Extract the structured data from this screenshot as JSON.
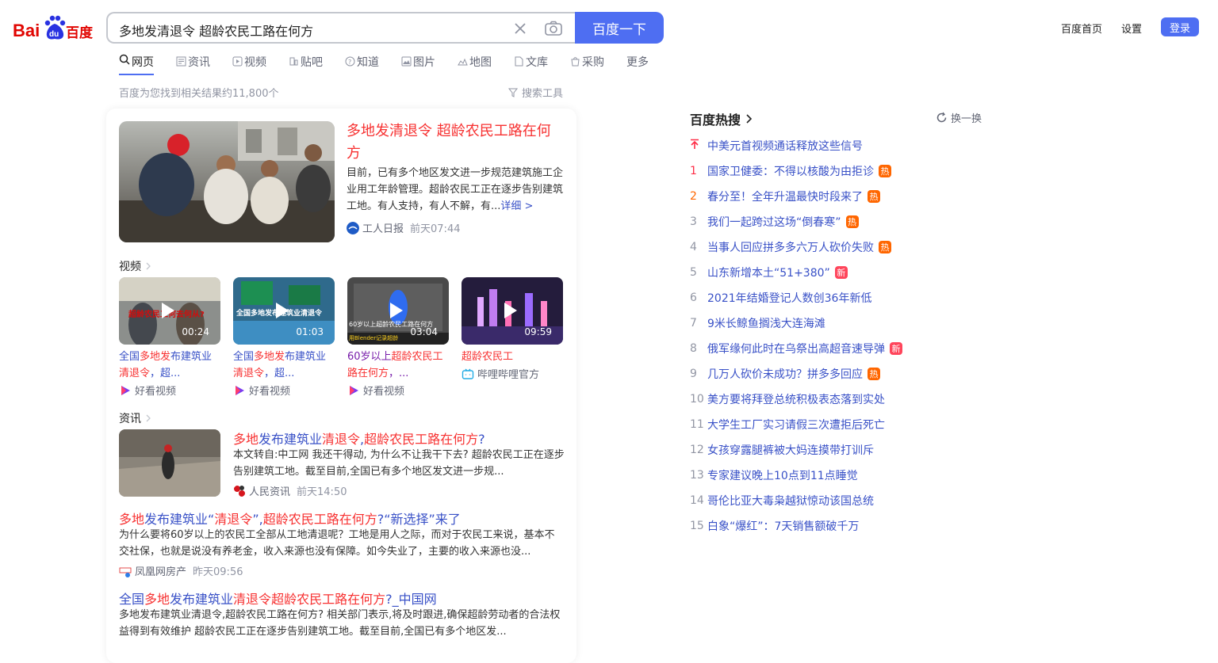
{
  "header": {
    "search_query": "多地发清退令 超龄农民工路在何方",
    "search_button": "百度一下",
    "links": [
      "百度首页",
      "设置"
    ],
    "login": "登录",
    "brand_color": "#4e6ef2"
  },
  "tabs": [
    {
      "label": "网页",
      "icon": "search-icon"
    },
    {
      "label": "资讯",
      "icon": "news-icon"
    },
    {
      "label": "视频",
      "icon": "video-icon"
    },
    {
      "label": "贴吧",
      "icon": "tieba-icon"
    },
    {
      "label": "知道",
      "icon": "question-icon"
    },
    {
      "label": "图片",
      "icon": "image-icon"
    },
    {
      "label": "地图",
      "icon": "map-icon"
    },
    {
      "label": "文库",
      "icon": "document-icon"
    },
    {
      "label": "采购",
      "icon": "shopping-icon"
    },
    {
      "label": "更多",
      "icon": ""
    }
  ],
  "result_count": "百度为您找到相关结果约11,800个",
  "search_tools": "搜索工具",
  "top_result": {
    "title": "多地发清退令 超龄农民工路在何方",
    "summary": "目前，已有多个地区发文进一步规范建筑施工企业用工年龄管理。超龄农民工正在逐步告别建筑工地。有人支持，有人不解，有...",
    "more": "详细 >",
    "source": "工人日报",
    "time": "前天07:44"
  },
  "video_section": {
    "label": "视频",
    "items": [
      {
        "duration": "00:24",
        "title_a": "全国",
        "title_em": "多地发",
        "title_b": "布建筑业",
        "title_em2": "清退令",
        "title_c": "，超...",
        "source": "好看视频"
      },
      {
        "duration": "01:03",
        "title_a": "全国",
        "title_em": "多地发",
        "title_b": "布建筑业",
        "title_em2": "清退令",
        "title_c": "，超...",
        "source": "好看视频"
      },
      {
        "duration": "03:04",
        "title_a": "60岁以上",
        "title_em": "超龄农民工",
        "title_b": "",
        "title_em2": "路在何方",
        "title_c": "，...",
        "source": "好看视频"
      },
      {
        "duration": "09:59",
        "title_a": "",
        "title_em": "超龄农民工",
        "title_b": "",
        "title_em2": "",
        "title_c": "",
        "source": "哔哩哔哩官方"
      }
    ]
  },
  "news_section": {
    "label": "资讯",
    "items": [
      {
        "t1": "多地",
        "t2": "发布建筑业",
        "t3": "清退令",
        "t4": ",",
        "t5": "超龄农民工路在何方",
        "t6": "?",
        "summary": "本文转自:中工网 我还干得动, 为什么不让我干下去? 超龄农民工正在逐步告别建筑工地。截至目前,全国已有多个地区发文进一步规...",
        "source": "人民资讯",
        "time": "前天14:50"
      },
      {
        "t1": "多地",
        "t2": "发布建筑业“",
        "t3": "清退令",
        "t4": "”,",
        "t5": "超龄农民工路在何方",
        "t6": "?“新选择”来了",
        "summary": "为什么要将60岁以上的农民工全部从工地清退呢？工地是用人之际，而对于农民工来说，基本不交社保，也就是说没有养老金，收入来源也没有保障。如今失业了，主要的收入来源也没...",
        "source": "凤凰网房产",
        "time": "昨天09:56"
      },
      {
        "t0": "全国",
        "t1": "多地",
        "t2": "发布建筑业",
        "t3": "清退令",
        "t4": "",
        "t5": "超龄农民工路在何方",
        "t6": "?_中国网",
        "summary": "多地发布建筑业清退令,超龄农民工路在何方? 相关部门表示,将及时跟进,确保超龄劳动者的合法权益得到有效维护 超龄农民工正在逐步告别建筑工地。截至目前,全国已有多个地区发..."
      }
    ]
  },
  "hot_search": {
    "title": "百度热搜",
    "refresh": "换一换",
    "items": [
      {
        "rank": "",
        "text": "中美元首视频通话释放这些信号",
        "tag": ""
      },
      {
        "rank": "1",
        "text": "国家卫健委：不得以核酸为由拒诊",
        "tag": "热"
      },
      {
        "rank": "2",
        "text": "春分至！全年升温最快时段来了",
        "tag": "热"
      },
      {
        "rank": "3",
        "text": "我们一起跨过这场“倒春寒”",
        "tag": "热"
      },
      {
        "rank": "4",
        "text": "当事人回应拼多多六万人砍价失败",
        "tag": "热"
      },
      {
        "rank": "5",
        "text": "山东新增本土“51+380”",
        "tag": "新"
      },
      {
        "rank": "6",
        "text": "2021年结婚登记人数创36年新低",
        "tag": ""
      },
      {
        "rank": "7",
        "text": "9米长鲸鱼搁浅大连海滩",
        "tag": ""
      },
      {
        "rank": "8",
        "text": "俄军缘何此时在乌祭出高超音速导弹",
        "tag": "新"
      },
      {
        "rank": "9",
        "text": "几万人砍价未成功？拼多多回应",
        "tag": "热"
      },
      {
        "rank": "10",
        "text": "美方要将拜登总统积极表态落到实处",
        "tag": ""
      },
      {
        "rank": "11",
        "text": "大学生工厂实习请假三次遭拒后死亡",
        "tag": ""
      },
      {
        "rank": "12",
        "text": "女孩穿露腿裤被大妈连摸带打训斥",
        "tag": ""
      },
      {
        "rank": "13",
        "text": "专家建议晚上10点到11点睡觉",
        "tag": ""
      },
      {
        "rank": "14",
        "text": "哥伦比亚大毒枭越狱惊动该国总统",
        "tag": ""
      },
      {
        "rank": "15",
        "text": "白象“爆红”：7天销售额破千万",
        "tag": ""
      }
    ]
  }
}
